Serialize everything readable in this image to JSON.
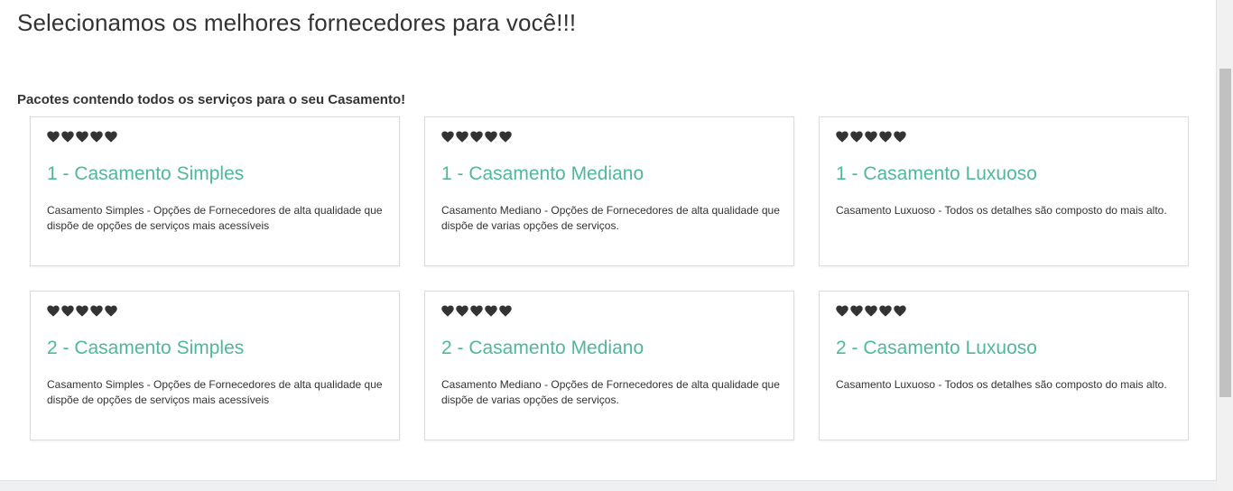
{
  "header": {
    "title": "Selecionamos os melhores fornecedores para você!!!",
    "subtitle": "Pacotes contendo todos os serviços para o seu Casamento!"
  },
  "colors": {
    "accent": "#4fb89c",
    "heart": "#333333"
  },
  "cards": [
    {
      "rating": 5,
      "rating_icon": "heart-icon",
      "title": "1 - Casamento Simples",
      "description": "Casamento Simples - Opções de Fornecedores de alta qualidade que dispõe de opções de serviços mais acessíveis"
    },
    {
      "rating": 5,
      "rating_icon": "heart-icon",
      "title": "1 - Casamento Mediano",
      "description": "Casamento Mediano - Opções de Fornecedores de alta qualidade que dispõe de varias opções de serviços."
    },
    {
      "rating": 5,
      "rating_icon": "heart-icon",
      "title": "1 - Casamento Luxuoso",
      "description": "Casamento Luxuoso - Todos os detalhes são composto do mais alto."
    },
    {
      "rating": 5,
      "rating_icon": "heart-icon",
      "title": "2 - Casamento Simples",
      "description": "Casamento Simples - Opções de Fornecedores de alta qualidade que dispõe de opções de serviços mais acessíveis"
    },
    {
      "rating": 5,
      "rating_icon": "heart-icon",
      "title": "2 - Casamento Mediano",
      "description": "Casamento Mediano - Opções de Fornecedores de alta qualidade que dispõe de varias opções de serviços."
    },
    {
      "rating": 5,
      "rating_icon": "heart-icon",
      "title": "2 - Casamento Luxuoso",
      "description": "Casamento Luxuoso - Todos os detalhes são composto do mais alto."
    }
  ]
}
